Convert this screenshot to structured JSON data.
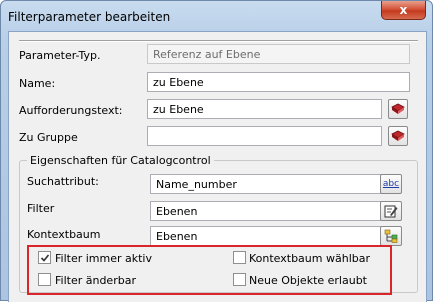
{
  "window": {
    "title": "Filterparameter bearbeiten",
    "close_label": "x"
  },
  "form": {
    "parameter_typ": {
      "label": "Parameter-Typ.",
      "value": "Referenz auf Ebene"
    },
    "name": {
      "label": "Name:",
      "value": "zu Ebene"
    },
    "aufforderungstext": {
      "label": "Aufforderungstext:",
      "value": "zu Ebene"
    },
    "zu_gruppe": {
      "label": "Zu Gruppe",
      "value": ""
    }
  },
  "catalog_group": {
    "title": "Eigenschaften für Catalogcontrol",
    "suchattribut": {
      "label": "Suchattribut:",
      "value": "Name_number",
      "icon": "abc-icon"
    },
    "filter": {
      "label": "Filter",
      "value": "Ebenen",
      "icon": "edit-icon"
    },
    "kontextbaum": {
      "label": "Kontextbaum",
      "value": "Ebenen",
      "icon": "tree-icon"
    }
  },
  "checkboxes": {
    "filter_immer_aktiv": {
      "label": "Filter immer aktiv",
      "checked": true
    },
    "filter_aenderbar": {
      "label": "Filter änderbar",
      "checked": false
    },
    "kontextbaum_waehlbar": {
      "label": "Kontextbaum wählbar",
      "checked": false
    },
    "neue_objekte_erlaubt": {
      "label": "Neue Objekte erlaubt",
      "checked": false
    }
  },
  "icons": {
    "book_button_color": "#c0262c",
    "highlight_color": "#d9262b",
    "abc_label": "abc"
  }
}
